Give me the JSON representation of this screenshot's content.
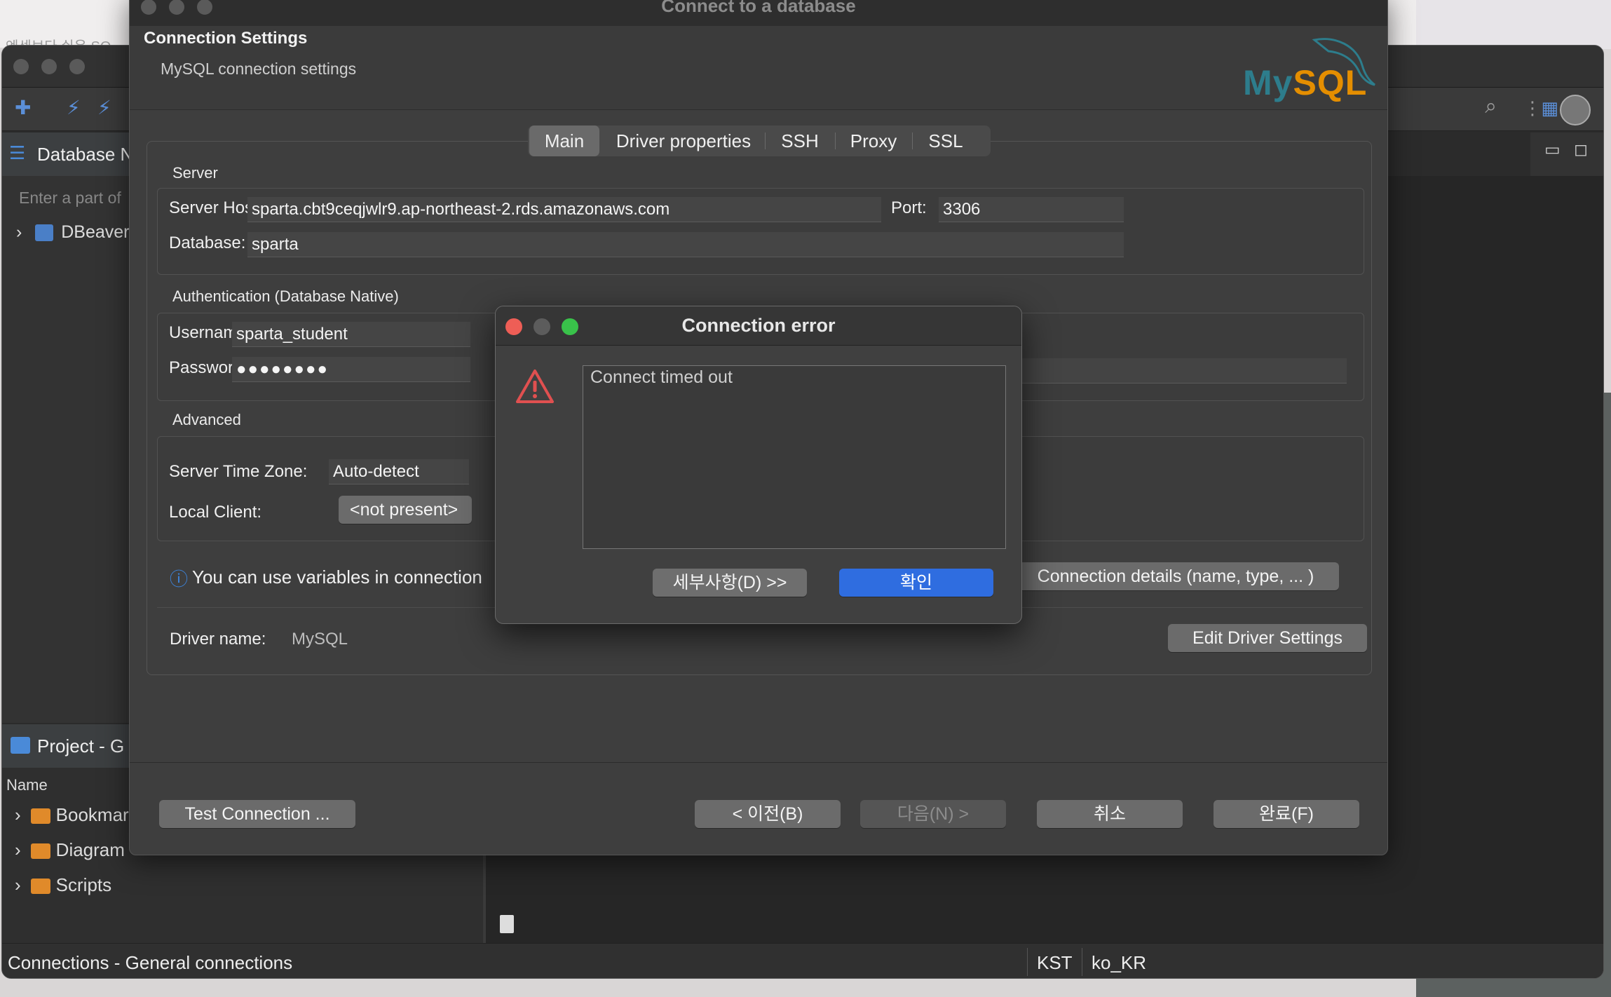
{
  "desktop": {
    "behind_text": "엔센보다 쉬운 SQ"
  },
  "bg_app": {
    "db_navigator_tab": "Database N",
    "filter_placeholder": "Enter a part of",
    "tree_root": "DBeaver",
    "project_tab": "Project - G",
    "name_header": "Name",
    "project_items": [
      "Bookmar",
      "Diagram",
      "Scripts"
    ],
    "status": {
      "left": "Connections - General connections",
      "timezone": "KST",
      "locale": "ko_KR"
    }
  },
  "wizard": {
    "title": "Connect to a database",
    "heading": "Connection Settings",
    "subheading": "MySQL connection settings",
    "tabs": [
      "Main",
      "Driver properties",
      "SSH",
      "Proxy",
      "SSL"
    ],
    "active_tab": "Main",
    "server": {
      "group": "Server",
      "host_label": "Server Host:",
      "host_value": "sparta.cbt9ceqjwlr9.ap-northeast-2.rds.amazonaws.com",
      "port_label": "Port:",
      "port_value": "3306",
      "database_label": "Database:",
      "database_value": "sparta"
    },
    "auth": {
      "group": "Authentication (Database Native)",
      "username_label": "Username:",
      "username_value": "sparta_student",
      "password_label": "Password:",
      "password_value": "●●●●●●●●"
    },
    "advanced": {
      "group": "Advanced",
      "timezone_label": "Server Time Zone:",
      "timezone_value": "Auto-detect",
      "local_client_label": "Local Client:",
      "local_client_value": "<not present>"
    },
    "variables_hint": "You can use variables in connection",
    "connection_details_button": "Connection details (name, type, ... )",
    "driver_name_label": "Driver name:",
    "driver_name_value": "MySQL",
    "edit_driver_button": "Edit Driver Settings",
    "footer": {
      "test_connection": "Test Connection ...",
      "back": "< 이전(B)",
      "next": "다음(N) >",
      "cancel": "취소",
      "finish": "완료(F)"
    }
  },
  "error_dialog": {
    "title": "Connection error",
    "message": "Connect timed out",
    "details_button": "세부사항(D) >>",
    "ok_button": "확인"
  },
  "colors": {
    "accent_blue": "#2f6de0",
    "mysql_teal": "#2d7d8c",
    "mysql_orange": "#e48e00",
    "warning_red": "#e05050"
  }
}
